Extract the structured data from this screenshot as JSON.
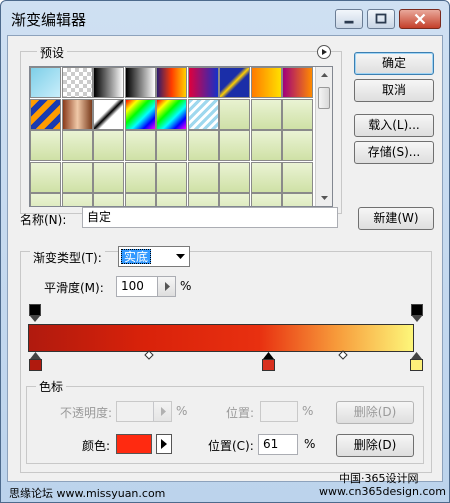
{
  "window": {
    "title": "渐变编辑器"
  },
  "presets": {
    "label": "预设"
  },
  "buttons": {
    "ok": "确定",
    "cancel": "取消",
    "load": "载入(L)...",
    "save": "存储(S)...",
    "new": "新建(W)",
    "delete_opacity": "删除(D)",
    "delete_color": "删除(D)"
  },
  "name_field": {
    "label": "名称(N):",
    "value": "自定"
  },
  "gradient_type": {
    "label": "渐变类型(T):",
    "value": "实底"
  },
  "smoothness": {
    "label": "平滑度(M):",
    "value": "100",
    "unit": "%"
  },
  "stops_section": {
    "label": "色标",
    "opacity_label": "不透明度:",
    "opacity_unit": "%",
    "opacity_location_label": "位置:",
    "opacity_location_unit": "%",
    "color_label": "颜色:",
    "color_value": "#ff2a10",
    "location_label": "位置(C):",
    "location_value": "61",
    "location_unit": "%"
  },
  "watermark": {
    "left": "思缘论坛 www.missyuan.com",
    "right_line1": "中国·365设计网",
    "right_line2": "www.cn365design.com"
  }
}
